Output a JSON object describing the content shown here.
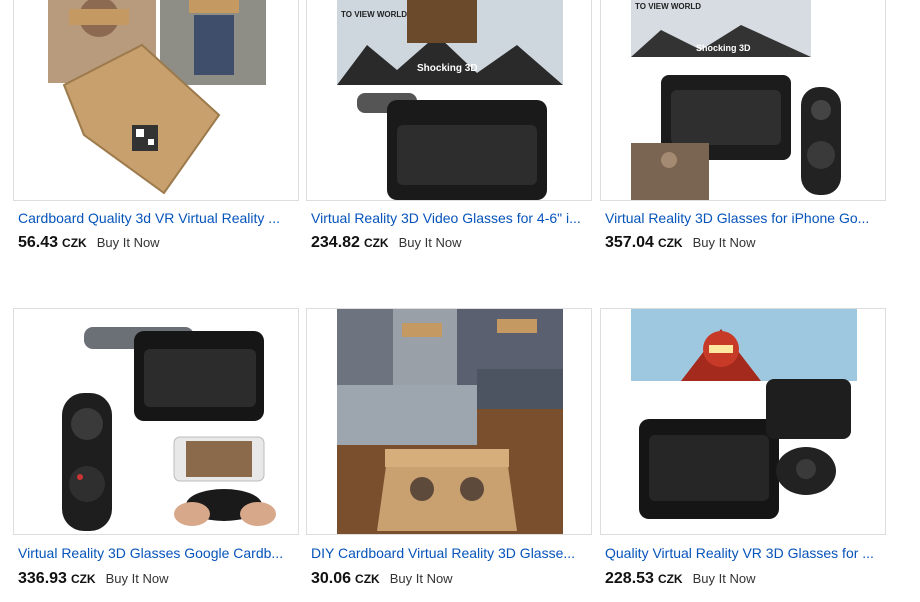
{
  "listings": [
    {
      "title": "Cardboard Quality 3d VR Virtual Reality ...",
      "price": "56.43",
      "currency": "CZK",
      "buy_label": "Buy It Now",
      "image": "cardboard-vr-people-photo"
    },
    {
      "title": "Virtual Reality 3D Video Glasses for 4-6\" i...",
      "price": "234.82",
      "currency": "CZK",
      "buy_label": "Buy It Now",
      "image": "black-vr-headset-ad-photo",
      "ad_text_1": "TO VIEW WORLD",
      "ad_text_2": "Shocking 3D"
    },
    {
      "title": "Virtual Reality 3D Glasses for iPhone Go...",
      "price": "357.04",
      "currency": "CZK",
      "buy_label": "Buy It Now",
      "image": "vr-headset-with-controller-photo",
      "ad_text_1": "TO VIEW WORLD",
      "ad_text_2": "Shocking 3D"
    },
    {
      "title": "Virtual Reality 3D Glasses Google Cardb...",
      "price": "336.93",
      "currency": "CZK",
      "buy_label": "Buy It Now",
      "image": "headset-controller-phone-photo"
    },
    {
      "title": "DIY Cardboard Virtual Reality 3D Glasse...",
      "price": "30.06",
      "currency": "CZK",
      "buy_label": "Buy It Now",
      "image": "diy-cardboard-collage-photo"
    },
    {
      "title": "Quality Virtual Reality VR 3D Glasses for ...",
      "price": "228.53",
      "currency": "CZK",
      "buy_label": "Buy It Now",
      "image": "ironman-vr-headset-photo"
    }
  ]
}
